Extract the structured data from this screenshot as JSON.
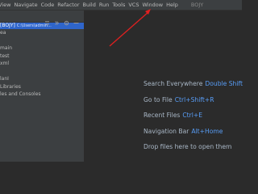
{
  "menubar": {
    "items": [
      "View",
      "Navigate",
      "Code",
      "Refactor",
      "Build",
      "Run",
      "Tools",
      "VCS",
      "Window",
      "Help"
    ],
    "project_name": "BOJY"
  },
  "sidebar": {
    "selected_row": {
      "name": "[BOJY]",
      "path": "C:\\Users\\admin..."
    },
    "rows": [
      "ea",
      "",
      "main",
      "test",
      "xml",
      "",
      "lanI",
      "Libraries",
      "les and Consoles"
    ]
  },
  "editor_hints": [
    {
      "label": "Search Everywhere",
      "shortcut": "Double Shift"
    },
    {
      "label": "Go to File",
      "shortcut": "Ctrl+Shift+R"
    },
    {
      "label": "Recent Files",
      "shortcut": "Ctrl+E"
    },
    {
      "label": "Navigation Bar",
      "shortcut": "Alt+Home"
    },
    {
      "label": "Drop files here to open them",
      "shortcut": ""
    }
  ],
  "annotation": {
    "arrow_color": "#e02020"
  }
}
